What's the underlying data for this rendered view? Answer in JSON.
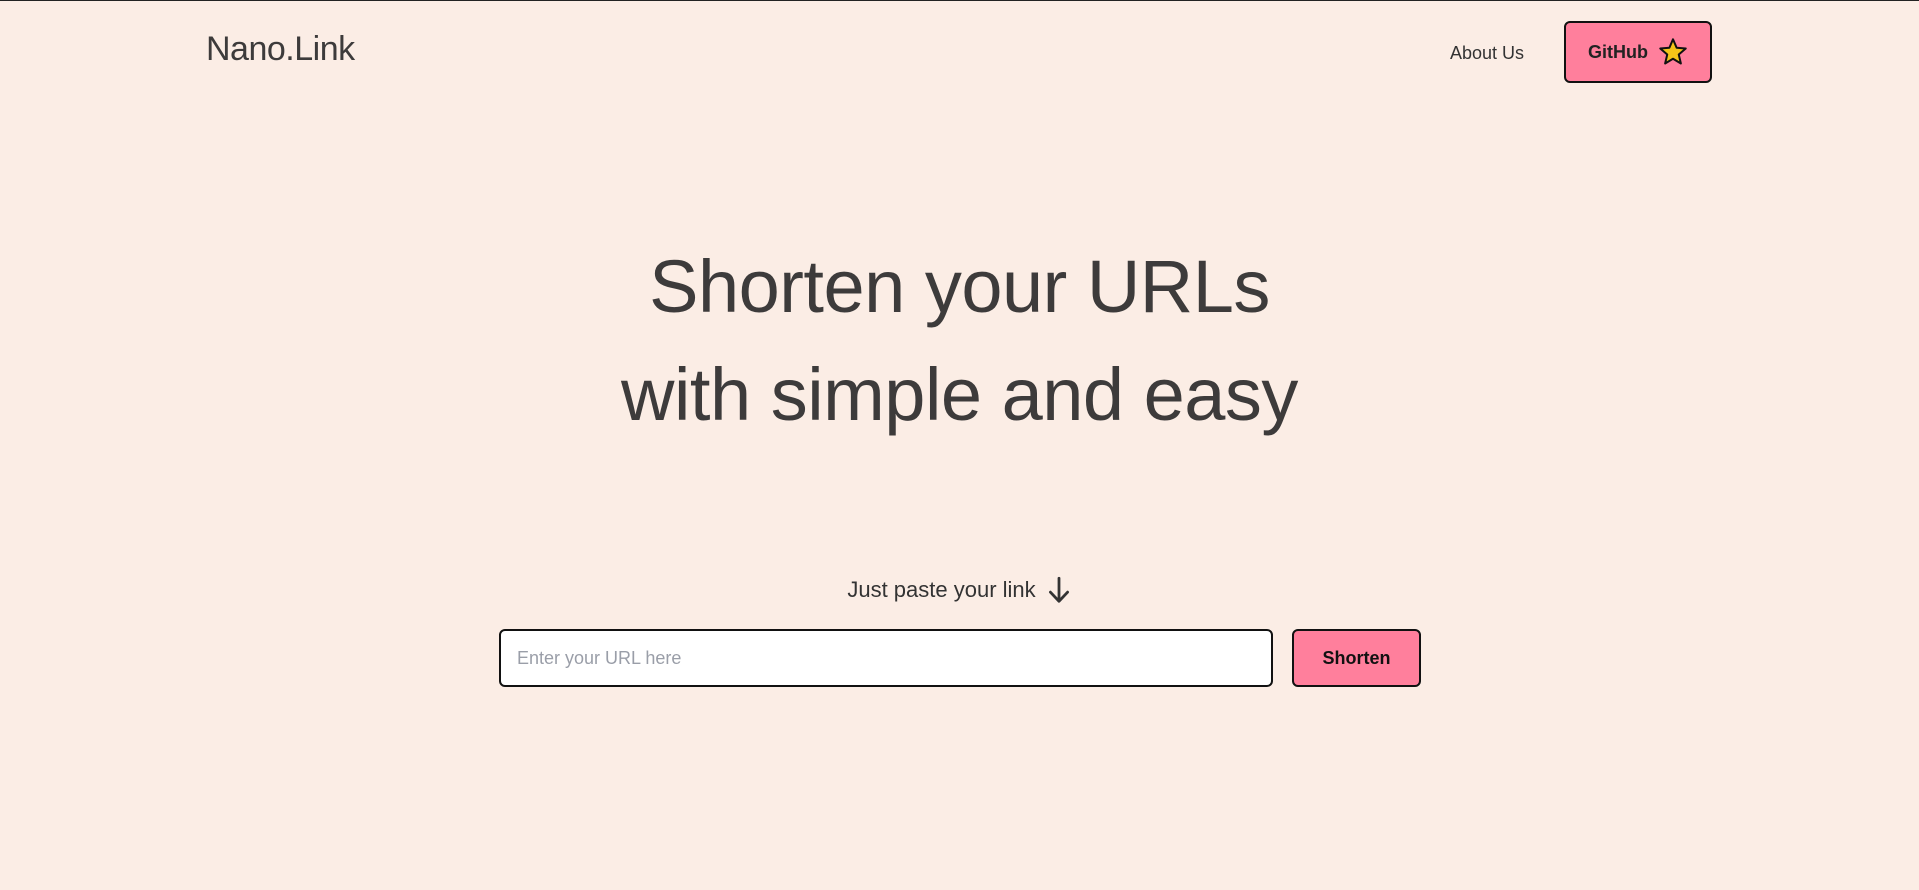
{
  "header": {
    "logo": "Nano.Link",
    "nav": {
      "about_label": "About Us",
      "github_label": "GitHub",
      "github_icon": "star-icon"
    }
  },
  "hero": {
    "line1": "Shorten your URLs",
    "line2": "with simple and easy"
  },
  "form": {
    "prompt": "Just paste your link",
    "prompt_icon": "arrow-down-icon",
    "url_input": {
      "value": "",
      "placeholder": "Enter your URL here"
    },
    "submit_label": "Shorten"
  },
  "colors": {
    "background": "#fbede5",
    "accent": "#ff7f9c",
    "star": "#f5c518",
    "text": "#3d3b3b",
    "border": "#111111"
  }
}
